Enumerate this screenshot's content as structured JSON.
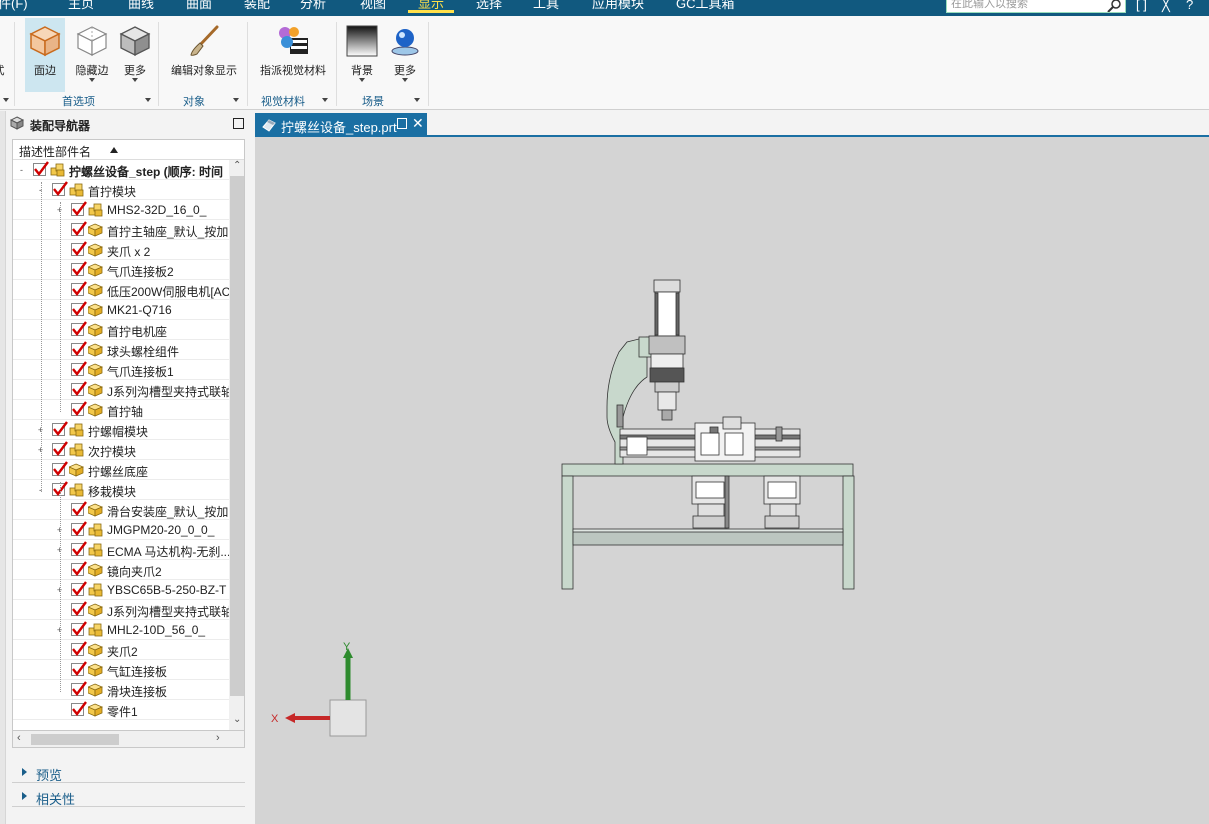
{
  "menu": {
    "items": [
      "件(F)",
      "主页",
      "曲线",
      "曲面",
      "装配",
      "分析",
      "视图",
      "显示",
      "选择",
      "工具",
      "应用模块",
      "GC工具箱"
    ],
    "active": "显示",
    "search_placeholder": "在此输入以搜索"
  },
  "ribbon": {
    "buttons": {
      "left_cut": "式",
      "face_edge": "面边",
      "hidden_edge": "隐藏边",
      "more1": "更多",
      "edit_display": "编辑对象显示",
      "assign_material": "指派视觉材料",
      "background": "背景",
      "more2": "更多"
    },
    "groups": {
      "preferences": "首选项",
      "object": "对象",
      "visual_material": "视觉材料",
      "scene": "场景"
    }
  },
  "navigator": {
    "title": "装配导航器",
    "column_header": "描述性部件名",
    "rows": [
      {
        "label": "拧螺丝设备_step (顺序: 时间",
        "level": 0,
        "expander": "-",
        "type": "assembly",
        "bold": true
      },
      {
        "label": "首拧模块",
        "level": 1,
        "expander": "-",
        "type": "assembly"
      },
      {
        "label": "MHS2-32D_16_0_",
        "level": 2,
        "expander": "+",
        "type": "assembly"
      },
      {
        "label": "首拧主轴座_默认_按加...",
        "level": 2,
        "expander": "",
        "type": "part"
      },
      {
        "label": "夹爪 x 2",
        "level": 2,
        "expander": "",
        "type": "part"
      },
      {
        "label": "气爪连接板2",
        "level": 2,
        "expander": "",
        "type": "part"
      },
      {
        "label": "低压200W伺服电机[AC",
        "level": 2,
        "expander": "",
        "type": "part"
      },
      {
        "label": "MK21-Q716",
        "level": 2,
        "expander": "",
        "type": "part"
      },
      {
        "label": "首拧电机座",
        "level": 2,
        "expander": "",
        "type": "part"
      },
      {
        "label": "球头螺栓组件",
        "level": 2,
        "expander": "",
        "type": "part"
      },
      {
        "label": "气爪连接板1",
        "level": 2,
        "expander": "",
        "type": "part"
      },
      {
        "label": "J系列沟槽型夹持式联轴",
        "level": 2,
        "expander": "",
        "type": "part"
      },
      {
        "label": "首拧轴",
        "level": 2,
        "expander": "",
        "type": "part"
      },
      {
        "label": "拧螺帽模块",
        "level": 1,
        "expander": "+",
        "type": "assembly"
      },
      {
        "label": "次拧模块",
        "level": 1,
        "expander": "+",
        "type": "assembly"
      },
      {
        "label": "拧螺丝底座",
        "level": 1,
        "expander": "",
        "type": "part"
      },
      {
        "label": "移栽模块",
        "level": 1,
        "expander": "-",
        "type": "assembly"
      },
      {
        "label": "滑台安装座_默认_按加...",
        "level": 2,
        "expander": "",
        "type": "part"
      },
      {
        "label": "JMGPM20-20_0_0_",
        "level": 2,
        "expander": "+",
        "type": "assembly"
      },
      {
        "label": "ECMA 马达机构-无刹...",
        "level": 2,
        "expander": "+",
        "type": "assembly"
      },
      {
        "label": "镜向夹爪2",
        "level": 2,
        "expander": "",
        "type": "part"
      },
      {
        "label": "YBSC65B-5-250-BZ-T",
        "level": 2,
        "expander": "+",
        "type": "assembly"
      },
      {
        "label": "J系列沟槽型夹持式联轴",
        "level": 2,
        "expander": "",
        "type": "part"
      },
      {
        "label": "MHL2-10D_56_0_",
        "level": 2,
        "expander": "+",
        "type": "assembly"
      },
      {
        "label": "夹爪2",
        "level": 2,
        "expander": "",
        "type": "part"
      },
      {
        "label": "气缸连接板",
        "level": 2,
        "expander": "",
        "type": "part"
      },
      {
        "label": "滑块连接板",
        "level": 2,
        "expander": "",
        "type": "part"
      },
      {
        "label": "零件1",
        "level": 2,
        "expander": "",
        "type": "part"
      }
    ],
    "panels": [
      "预览",
      "相关性"
    ]
  },
  "tab": {
    "label": "拧螺丝设备_step.prt"
  },
  "triad": {
    "x_label": "X",
    "y_label": "Y"
  },
  "colors": {
    "accent": "#1a6fa3",
    "menubar": "#11597f",
    "check_red": "#d00000",
    "viewport": "#d4d4d4",
    "frame": "#c8d8cc"
  }
}
